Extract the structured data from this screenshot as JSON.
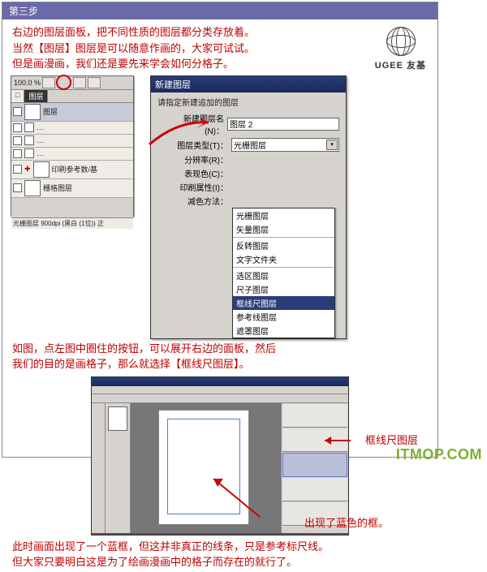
{
  "step_label": "第三步",
  "intro_lines": [
    "右边的图层面板，把不同性质的图层都分类存放着。",
    "当然【图层】图层是可以随意作画的，大家可试试。",
    "但是画漫画，我们还是要先来学会如何分格子。"
  ],
  "logo": {
    "brand": "UGEE 友基"
  },
  "layers_panel": {
    "zoom_value": "100.0 %",
    "tab_main": "图层",
    "row_layer": "图层",
    "row_print": "印刷参考数/基",
    "row_grid": "栅格图层",
    "mini1": "…",
    "mini2": "…",
    "mini3": "…",
    "status": "光栅图层  900dpi  (黑白 (1位)) 正"
  },
  "dialog": {
    "title": "新建图层",
    "prompt": "请指定新建追加的图层",
    "fields": {
      "name_label": "新建图层名(N)：",
      "name_value": "图层 2",
      "type_label": "图层类型(T)：",
      "type_value": "光栅图层",
      "res_label": "分辨率(R)：",
      "color_label": "表现色(C)：",
      "print_label": "印刷属性(I)：",
      "reduce_label": "减色方法："
    },
    "options": {
      "opt_raster": "光栅图层",
      "opt_vector": "矢量图层",
      "opt_rev": "反转图层",
      "opt_textfolder": "文字文件夹",
      "opt_sel": "选区图层",
      "opt_ruler": "尺子图层",
      "opt_frame": "框线尺图层",
      "opt_guide": "参考线图层",
      "opt_mask": "遮罩图层"
    }
  },
  "middle_text": [
    "如图，点左图中圈住的按钮，可以展开右边的面板，然后",
    "我们的目的是画格子，那么就选择【框线尺图层】。"
  ],
  "labels": {
    "frame_layer": "框线尺图层",
    "blue_box": "出现了蓝色的框。"
  },
  "bottom_text": [
    "此时画面出现了一个蓝框，但这并非真正的线条，只是参考标尺线。",
    "但大家只要明白这是为了绘画漫画中的格子而存在的就行了。"
  ],
  "watermark": "ITMOP.COM"
}
